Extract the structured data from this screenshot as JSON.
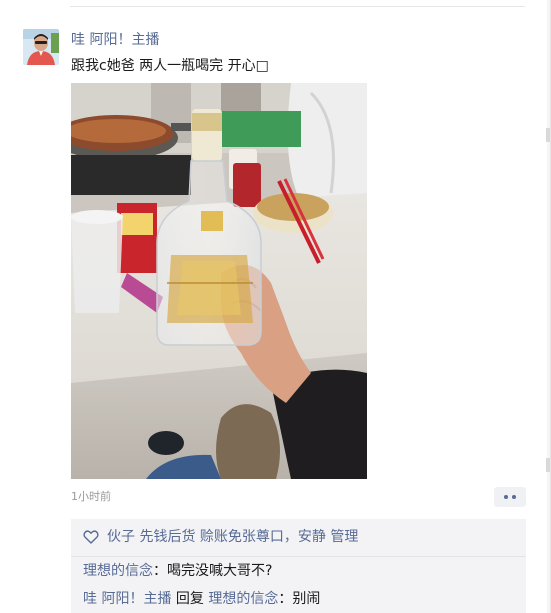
{
  "post": {
    "author": "哇 阿阳！主播",
    "text": "跟我c她爸 两人一瓶喝完 开心□",
    "timestamp": "1小时前"
  },
  "likes": {
    "names": "伙子 先钱后货 赊账免张尊口，安静 管理"
  },
  "comments": [
    {
      "author": "理想的信念",
      "separator": "：",
      "text": "喝完没喊大哥不?"
    },
    {
      "author": "哇 阿阳！主播",
      "reply_word": " 回复 ",
      "reply_to": "理想的信念",
      "separator": "：",
      "text": "别闹"
    }
  ],
  "icons": {
    "like": "heart-outline-icon",
    "more": "more-dots-icon"
  },
  "colors": {
    "link": "#576b95",
    "text": "#1a1a1a",
    "meta": "#9a9a9a",
    "feedback_bg": "#f3f3f5"
  }
}
